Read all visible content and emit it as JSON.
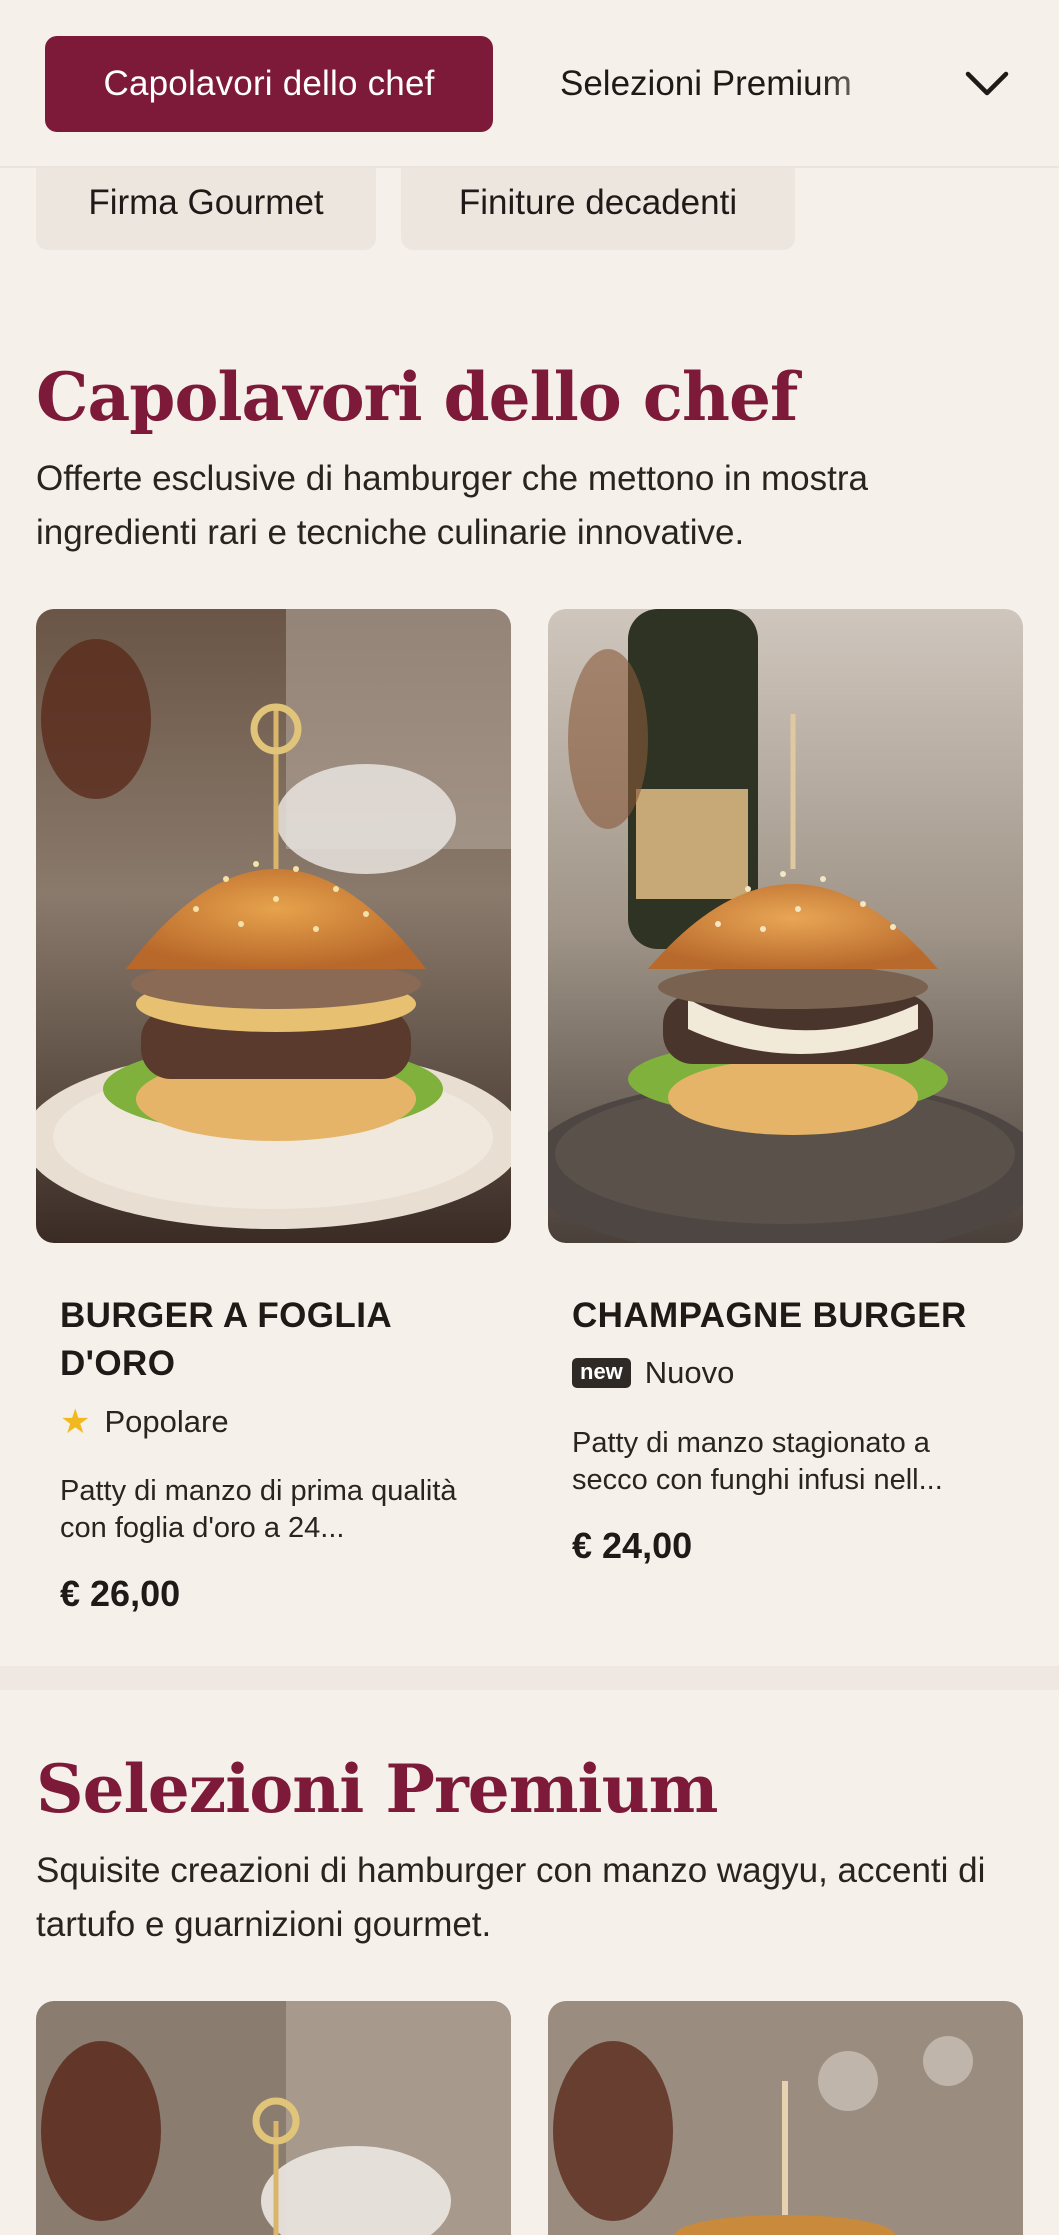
{
  "nav": {
    "active_tab": "Capolavori dello chef",
    "next_tab": "Selezioni Premium",
    "chevron_icon": "chevron-down-icon"
  },
  "chips": [
    "Firma Gourmet",
    "Finiture decadenti"
  ],
  "sections": [
    {
      "title": "Capolavori dello chef",
      "description": "Offerte esclusive di hamburger che mettono in mostra ingredienti rari e tecniche culinarie innovative.",
      "products": [
        {
          "name": "BURGER A FOGLIA D'ORO",
          "badge_icon": "star-icon",
          "badge_text": "Popolare",
          "description": "Patty di manzo di prima qualità con foglia d'oro a 24...",
          "price": "€ 26,00"
        },
        {
          "name": "CHAMPAGNE BURGER",
          "badge_tag": "new",
          "badge_text": "Nuovo",
          "description": "Patty di manzo stagionato a secco con funghi infusi nell...",
          "price": "€ 24,00"
        }
      ]
    },
    {
      "title": "Selezioni Premium",
      "description": "Squisite creazioni di hamburger con manzo wagyu, accenti di tartufo e guarnizioni gourmet."
    }
  ],
  "colors": {
    "brand": "#7d1a3a",
    "background": "#f5f1ea",
    "star": "#f2b81f"
  }
}
